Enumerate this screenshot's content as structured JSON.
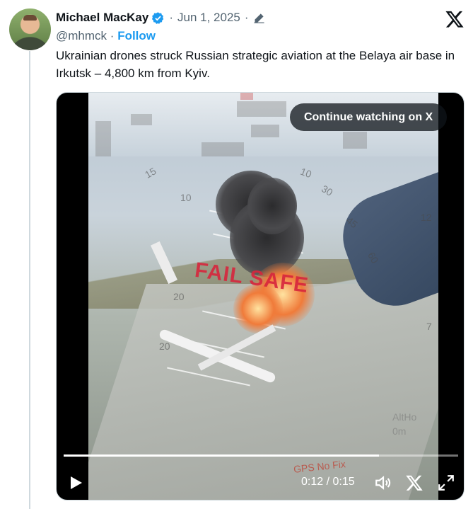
{
  "author": {
    "name": "Michael MacKay",
    "handle": "@mhmck",
    "separator": "·",
    "date": "Jun 1, 2025",
    "verified": true
  },
  "actions": {
    "follow_label": "Follow"
  },
  "tweet": {
    "text": "Ukrainian drones struck Russian strategic aviation at the Belaya air base in Irkutsk – 4,800 km from Kyiv."
  },
  "video": {
    "cta_label": "Continue watching on X",
    "current_time": "0:12",
    "duration": "0:15",
    "time_separator": "/",
    "progress_fraction": 0.8,
    "overlay_text": {
      "failsafe": "FAIL SAFE",
      "gps": "GPS No Fix",
      "alt": "AltHo",
      "alt_unit": "0m"
    },
    "hud_numbers": [
      "15",
      "10",
      "20",
      "30",
      "45",
      "60",
      "10",
      "20",
      "12",
      "7"
    ]
  },
  "icons": [
    "verified-badge-icon",
    "edit-icon",
    "x-logo-icon",
    "play-icon",
    "volume-icon",
    "x-logo-icon",
    "fullscreen-icon"
  ],
  "colors": {
    "accent": "#1d9bf0",
    "text": "#0f1419",
    "muted": "#536471",
    "failsafe": "#d7263d"
  }
}
